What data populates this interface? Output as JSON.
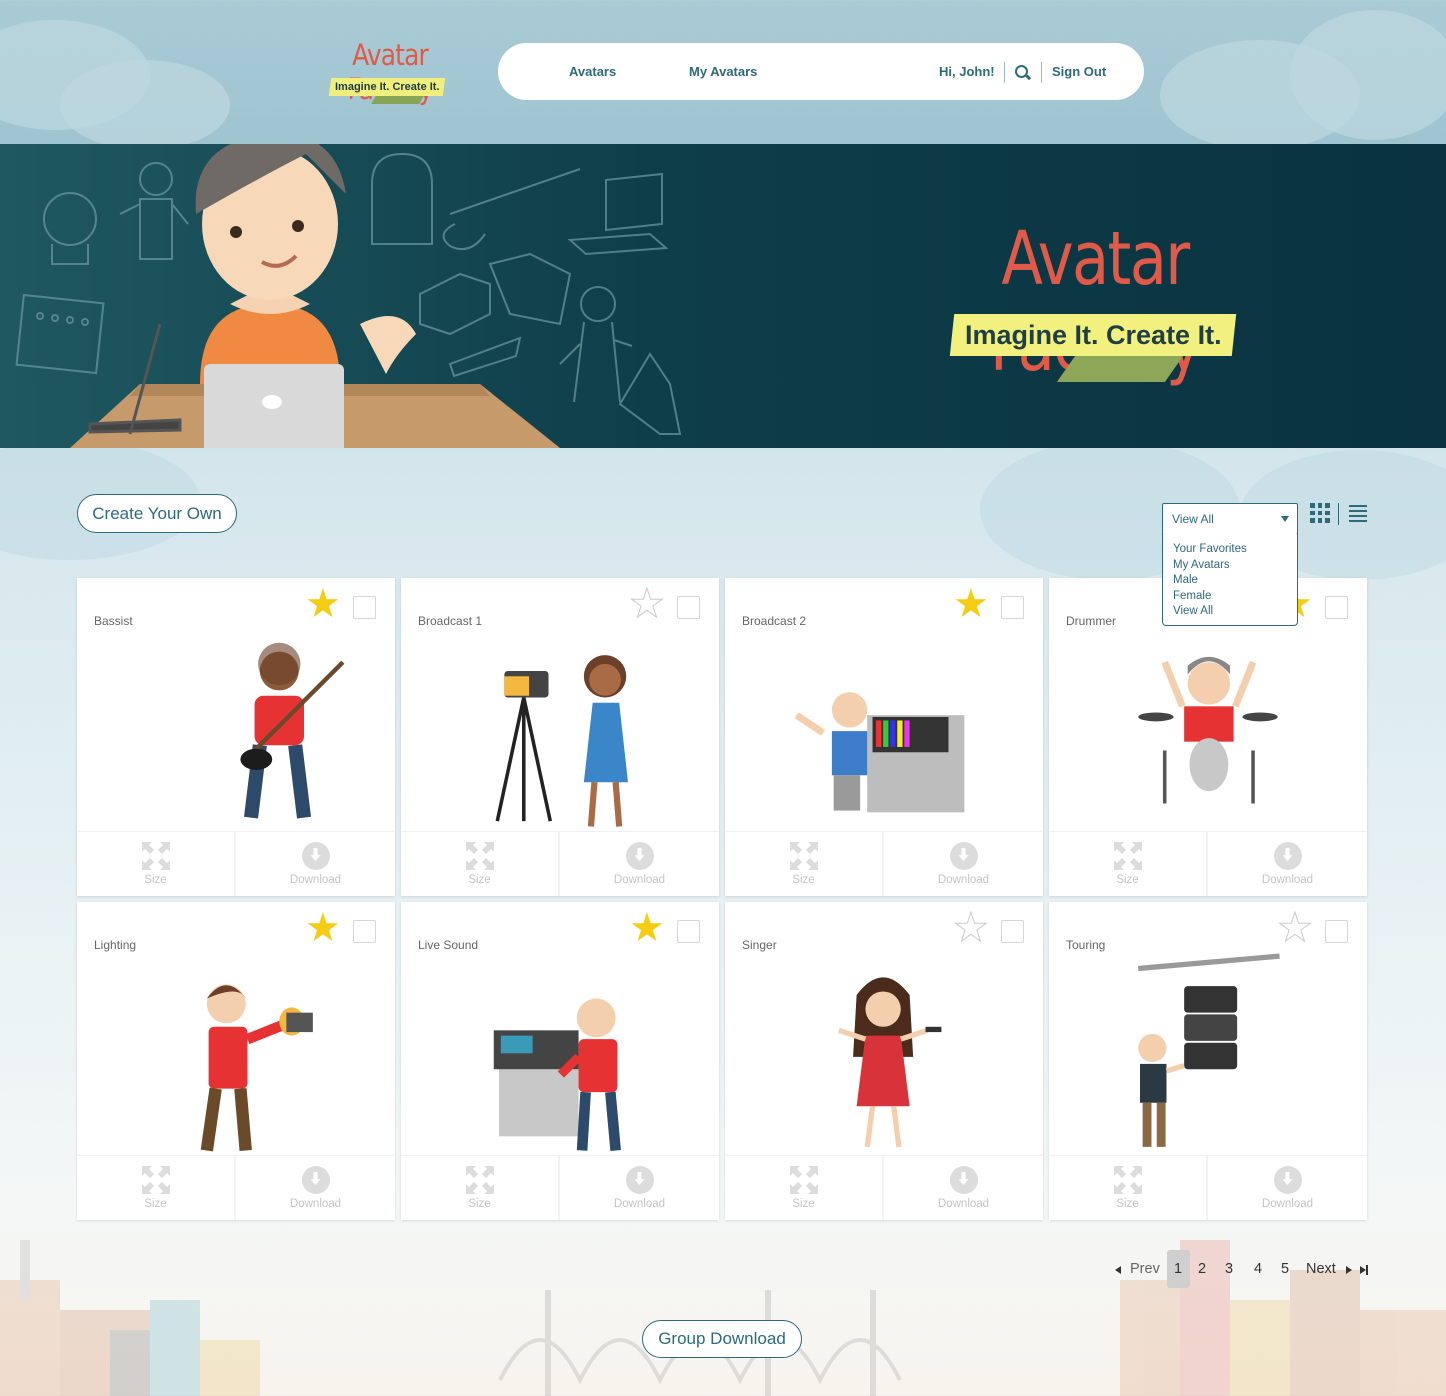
{
  "brand": {
    "name": "Avatar Factory",
    "tagline": "Imagine It. Create It.",
    "accent": "#e05a47",
    "primary": "#2c6a7c",
    "tag_color": "#f2f07f"
  },
  "nav": {
    "avatars": "Avatars",
    "my_avatars": "My Avatars",
    "greeting": "Hi, John!",
    "search_icon": "search-icon",
    "sign_out": "Sign Out"
  },
  "banner": {
    "title": "Avatar Factory",
    "tagline": "Imagine It. Create It."
  },
  "controls": {
    "create_button": "Create Your Own",
    "filter": {
      "selected": "View All",
      "options": [
        "Your Favorites",
        "My Avatars",
        "Male",
        "Female",
        "View All"
      ]
    },
    "grid_view_icon": "grid-view-icon",
    "list_view_icon": "list-view-icon"
  },
  "cards": [
    {
      "title": "Bassist",
      "favorite": true,
      "size_label": "Size",
      "download_label": "Download"
    },
    {
      "title": "Broadcast 1",
      "favorite": false,
      "size_label": "Size",
      "download_label": "Download"
    },
    {
      "title": "Broadcast 2",
      "favorite": true,
      "size_label": "Size",
      "download_label": "Download"
    },
    {
      "title": "Drummer",
      "favorite": true,
      "size_label": "Size",
      "download_label": "Download"
    },
    {
      "title": "Lighting",
      "favorite": true,
      "size_label": "Size",
      "download_label": "Download"
    },
    {
      "title": "Live Sound",
      "favorite": true,
      "size_label": "Size",
      "download_label": "Download"
    },
    {
      "title": "Singer",
      "favorite": false,
      "size_label": "Size",
      "download_label": "Download"
    },
    {
      "title": "Touring",
      "favorite": false,
      "size_label": "Size",
      "download_label": "Download"
    }
  ],
  "pagination": {
    "prev": "Prev",
    "pages": [
      "1",
      "2",
      "3",
      "4",
      "5"
    ],
    "current": "1",
    "next": "Next"
  },
  "footer": {
    "group_download": "Group Download"
  }
}
